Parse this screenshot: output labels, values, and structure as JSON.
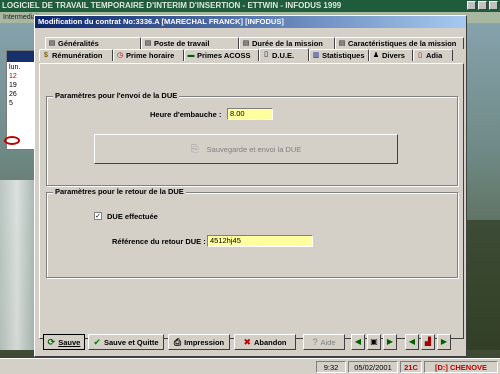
{
  "background": {
    "title": "LOGICIEL DE TRAVAIL TEMPORAIRE D'INTERIM D'INSERTION - ETTWIN - INFODUS 1999",
    "menu": "Intermediaire",
    "calendar_days": [
      "lun.",
      "12",
      "19",
      "26",
      "5"
    ]
  },
  "taskbar": {
    "time": "9:32",
    "date": "05/02/2001",
    "temp": "21C",
    "location": "[D:] CHENOVE"
  },
  "dialog": {
    "title": "Modification du contrat No:3336.A    [MARECHAL FRANCK] [INFODUS]",
    "tabs_row1": [
      {
        "label": "Généralités",
        "icon": "book-icon"
      },
      {
        "label": "Poste de travail",
        "icon": "book-icon"
      },
      {
        "label": "Durée de la mission",
        "icon": "book-icon"
      },
      {
        "label": "Caractéristiques de la mission",
        "icon": "book-icon"
      }
    ],
    "tabs_row2": [
      {
        "label": "Rémunération",
        "icon": "money-icon"
      },
      {
        "label": "Prime horaire",
        "icon": "clock-icon"
      },
      {
        "label": "Primes ACOSS",
        "icon": "bar-icon"
      },
      {
        "label": "D.U.E.",
        "icon": "doc-icon"
      },
      {
        "label": "Statistiques",
        "icon": "chart-icon"
      },
      {
        "label": "Divers",
        "icon": "people-icon"
      },
      {
        "label": "Adia",
        "icon": "doc-icon"
      }
    ],
    "envoi": {
      "title": "Paramètres pour l'envoi de la DUE",
      "heure_label": "Heure d'embauche :",
      "heure_value": "8.00",
      "save_send_label": "Sauvegarde et envoi la DUE"
    },
    "retour": {
      "title": "Paramètres pour le retour de la DUE",
      "due_checkbox_label": "DUE effectuée",
      "due_checked": true,
      "ref_label": "Référence du retour DUE :",
      "ref_value": "4512hj45"
    },
    "buttons": {
      "save": "Sauve",
      "save_quit": "Sauve et Quitte",
      "print": "Impression",
      "abandon": "Abandon",
      "help": "Aide"
    }
  }
}
